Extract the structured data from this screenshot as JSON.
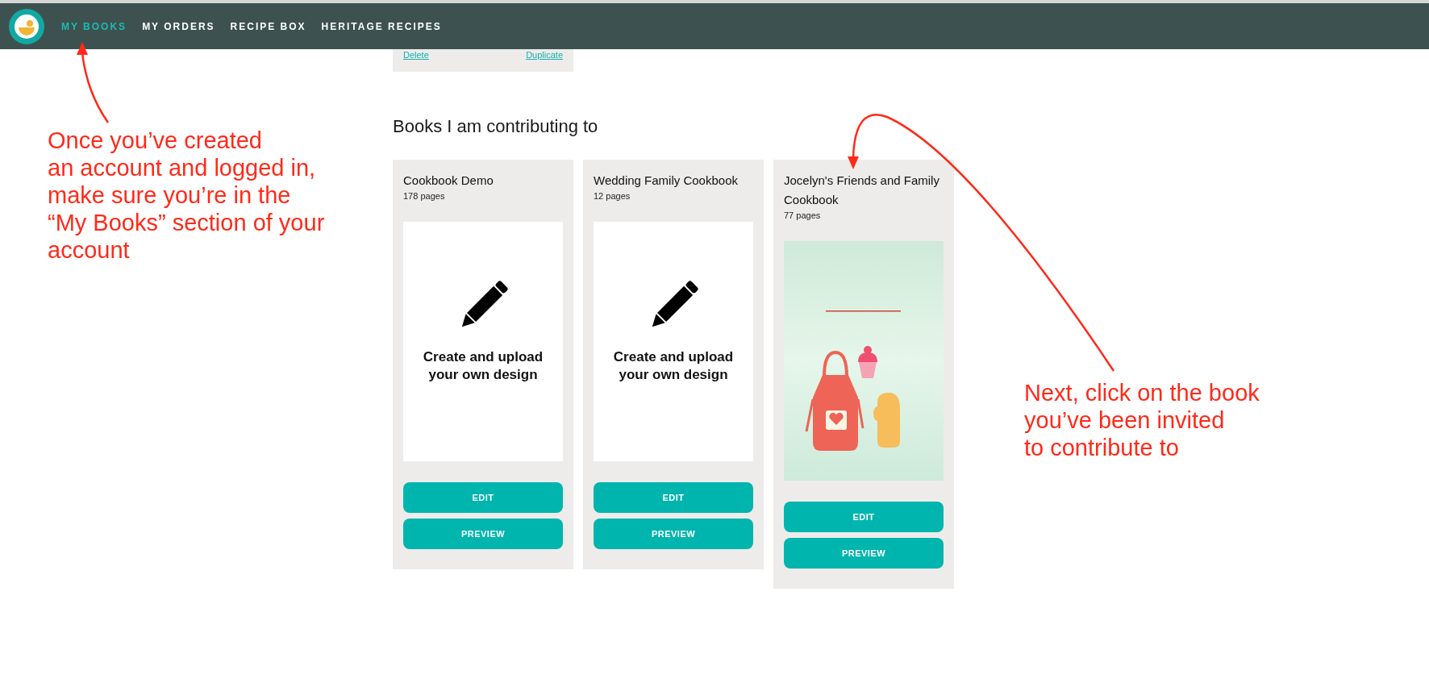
{
  "nav": {
    "items": [
      {
        "label": "MY BOOKS",
        "selected": true
      },
      {
        "label": "MY ORDERS",
        "selected": false
      },
      {
        "label": "RECIPE BOX",
        "selected": false
      },
      {
        "label": "HERITAGE RECIPES",
        "selected": false
      }
    ]
  },
  "previous_card": {
    "links": [
      "Delete",
      "Duplicate"
    ]
  },
  "section_title": "Books I am contributing to",
  "books": [
    {
      "title": "Cookbook Demo",
      "pages": "178 pages",
      "cover": {
        "kind": "placeholder",
        "caption": "Create and upload your own design"
      },
      "buttons": [
        "EDIT",
        "PREVIEW"
      ]
    },
    {
      "title": "Wedding Family Cookbook",
      "pages": "12 pages",
      "cover": {
        "kind": "placeholder",
        "caption": "Create and upload your own design"
      },
      "buttons": [
        "EDIT",
        "PREVIEW"
      ]
    },
    {
      "title": "Jocelyn's Friends and Family Cookbook",
      "pages": "77 pages",
      "cover": {
        "kind": "picture"
      },
      "buttons": [
        "EDIT",
        "PREVIEW"
      ]
    }
  ],
  "annotations": [
    {
      "lines": [
        "Once you’ve created",
        "an account and logged in,",
        "make sure you’re in the",
        "“My Books” section of your",
        "account"
      ]
    },
    {
      "lines": [
        "Next, click on the book",
        "you’ve been invited",
        "to contribute to"
      ]
    }
  ]
}
